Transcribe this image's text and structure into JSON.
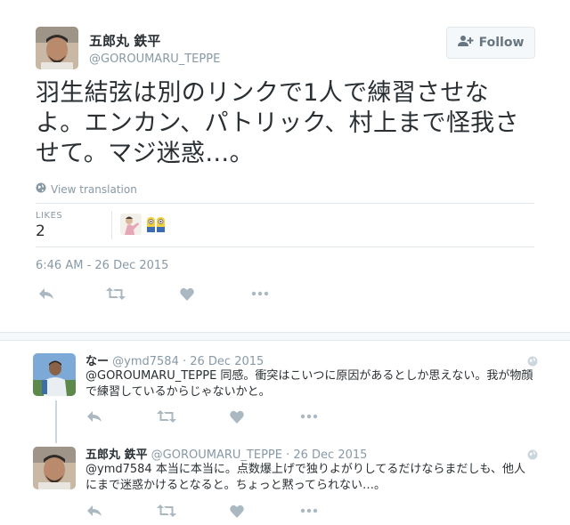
{
  "tweet": {
    "author_name": "五郎丸 鉄平",
    "author_handle": "@GOROUMARU_TEPPE",
    "follow_label": "Follow",
    "text": "羽生結弦は別のリンクで1人で練習させなよ。エンカン、パトリック、村上まで怪我させて。マジ迷惑…。",
    "view_translation_label": "View translation",
    "likes_label": "LIKES",
    "likes_count": "2",
    "timestamp": "6:46 AM - 26 Dec 2015"
  },
  "replies": [
    {
      "name": "なー",
      "meta": "@ymd7584 · 26 Dec 2015",
      "text": "@GOROUMARU_TEPPE 同感。衝突はこいつに原因があるとしか思えない。我が物顔で練習しているからじゃないかと。"
    },
    {
      "name": "五郎丸 鉄平",
      "meta": "@GOROUMARU_TEPPE · 26 Dec 2015",
      "text": "@ymd7584 本当に本当に。点数爆上げで独りよがりしてるだけならまだしも、他人にまで迷惑かけるとなると。ちょっと黙ってられない…。"
    }
  ],
  "colors": {
    "text": "#292f33",
    "muted": "#8899a6",
    "icon": "#aab8c2",
    "border": "#e1e8ed"
  },
  "icons": [
    "follow-person-icon",
    "globe-icon",
    "reply-icon",
    "retweet-icon",
    "like-heart-icon",
    "more-dots-icon"
  ]
}
